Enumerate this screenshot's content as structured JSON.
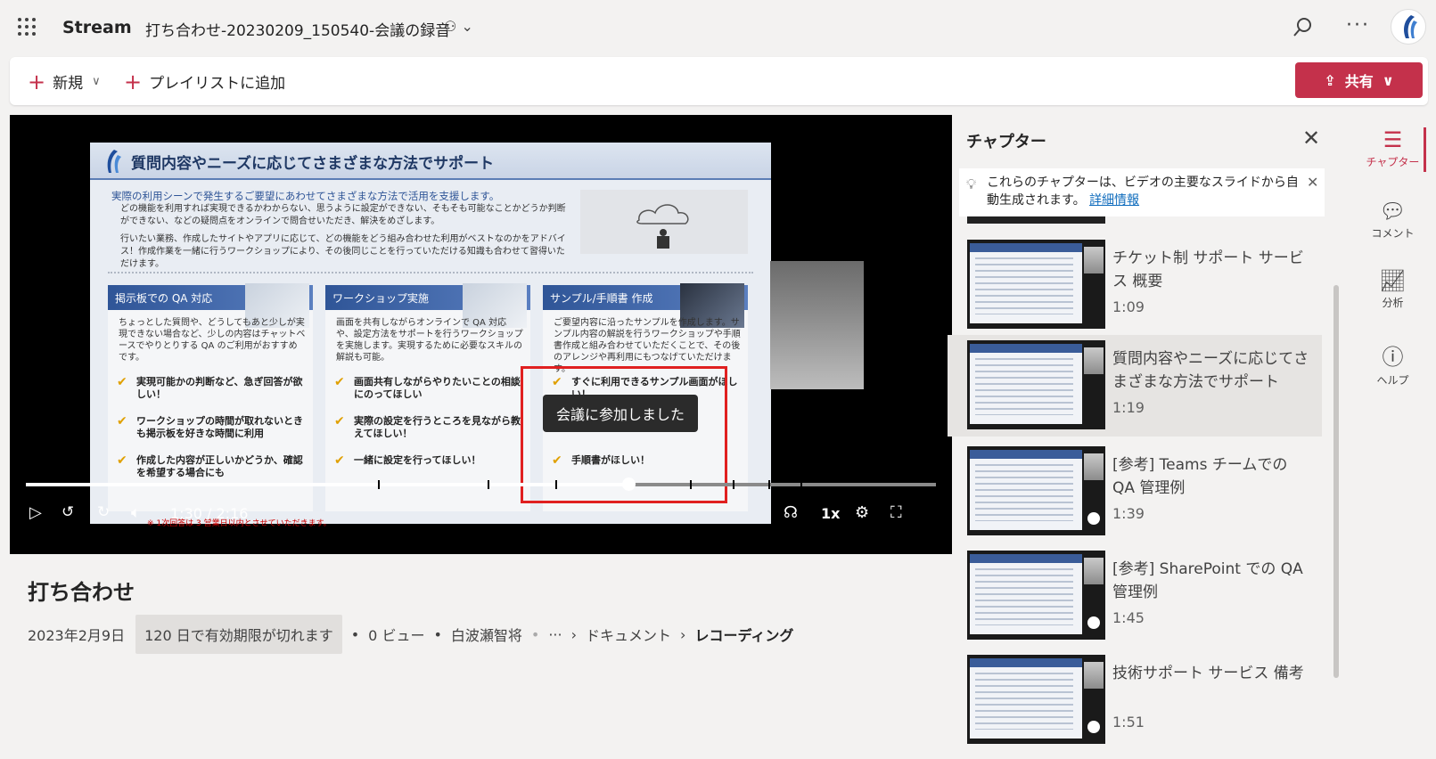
{
  "app": {
    "name": "Stream",
    "document_title": "打ち合わせ-20230209_150540-会議の録音"
  },
  "toolbar": {
    "new_label": "新規",
    "add_playlist_label": "プレイリストに追加",
    "share_label": "共有"
  },
  "slide": {
    "title": "質問内容やニーズに応じてさまざまな方法でサポート",
    "subtitle": "実際の利用シーンで発生するご要望にあわせてさまざまな方法で活用を支援します。",
    "bullets": [
      "どの機能を利用すれば実現できるかわからない、思うように設定ができない、そもそも可能なことかどうか判断ができない、などの疑問点をオンラインで問合せいただき、解決をめざします。",
      "行いたい業務、作成したサイトやアプリに応じて、どの機能をどう組み合わせた利用がベストなのかをアドバイス！作成作業を一緒に行うワークショップにより、その後同じことを行っていただける知識も合わせて習得いただけます。"
    ],
    "columns": [
      {
        "heading": "掲示板での QA 対応",
        "body": "ちょっとした質問や、どうしてもあと少しが実現できない場合など、少しの内容はチャットベースでやりとりする QA のご利用がおすすめです。",
        "checks": [
          "実現可能かの判断など、急ぎ回答が欲しい！",
          "ワークショップの時間が取れないときも掲示板を好きな時間に利用",
          "作成した内容が正しいかどうか、確認を希望する場合にも"
        ]
      },
      {
        "heading": "ワークショップ実施",
        "body": "画面を共有しながらオンラインで QA 対応や、設定方法をサポートを行うワークショップを実施します。実現するために必要なスキルの解説も可能。",
        "checks": [
          "画面共有しながらやりたいことの相談にのってほしい",
          "実際の設定を行うところを見ながら教えてほしい！",
          "一緒に設定を行ってほしい！"
        ]
      },
      {
        "heading": "サンプル/手順書 作成",
        "body": "ご要望内容に沿ったサンプルを作成します。サンプル内容の解説を行うワークショップや手順書作成と組み合わせていただくことで、その後のアレンジや再利用にもつなげていただけます。",
        "checks": [
          "すぐに利用できるサンプル画面がほしい！",
          "",
          "手順書がほしい！"
        ]
      }
    ],
    "note": "※ 1次回答は 3 営業日以内とさせていただきます。"
  },
  "player": {
    "toast": "会議に参加しました",
    "time": "1:30 / 2:16",
    "speed": "1x",
    "progress": 0.6624,
    "chapter_marks": [
      0.3873,
      0.5078,
      0.5814,
      0.7296,
      0.7769,
      0.8162,
      0.8514
    ]
  },
  "video": {
    "title": "打ち合わせ",
    "date": "2023年2月9日",
    "expiry": "120 日で有効期限が切れます",
    "views": "0 ビュー",
    "author": "白波瀬智将",
    "breadcrumb_1": "ドキュメント",
    "breadcrumb_2": "レコーディング"
  },
  "chapters": {
    "header": "チャプター",
    "info_text": "これらのチャプターは、ビデオの主要なスライドから自動生成されます。",
    "info_link": "詳細情報",
    "items": [
      {
        "title": "チケット制 サポート サービス 概要",
        "time": "1:09"
      },
      {
        "title": "質問内容やニーズに応じてさまざまな方法でサポート",
        "time": "1:19"
      },
      {
        "title": "[参考] Teams チームでの QA 管理例",
        "time": "1:39"
      },
      {
        "title": "[参考] SharePoint での QA 管理例",
        "time": "1:45"
      },
      {
        "title": "技術サポート サービス 備考",
        "time": "1:51"
      }
    ]
  },
  "rail": {
    "chapters": "チャプター",
    "comments": "コメント",
    "analytics": "分析",
    "help": "ヘルプ"
  },
  "colors": {
    "accent": "#c4314b",
    "highlight_box": "#e02020"
  }
}
